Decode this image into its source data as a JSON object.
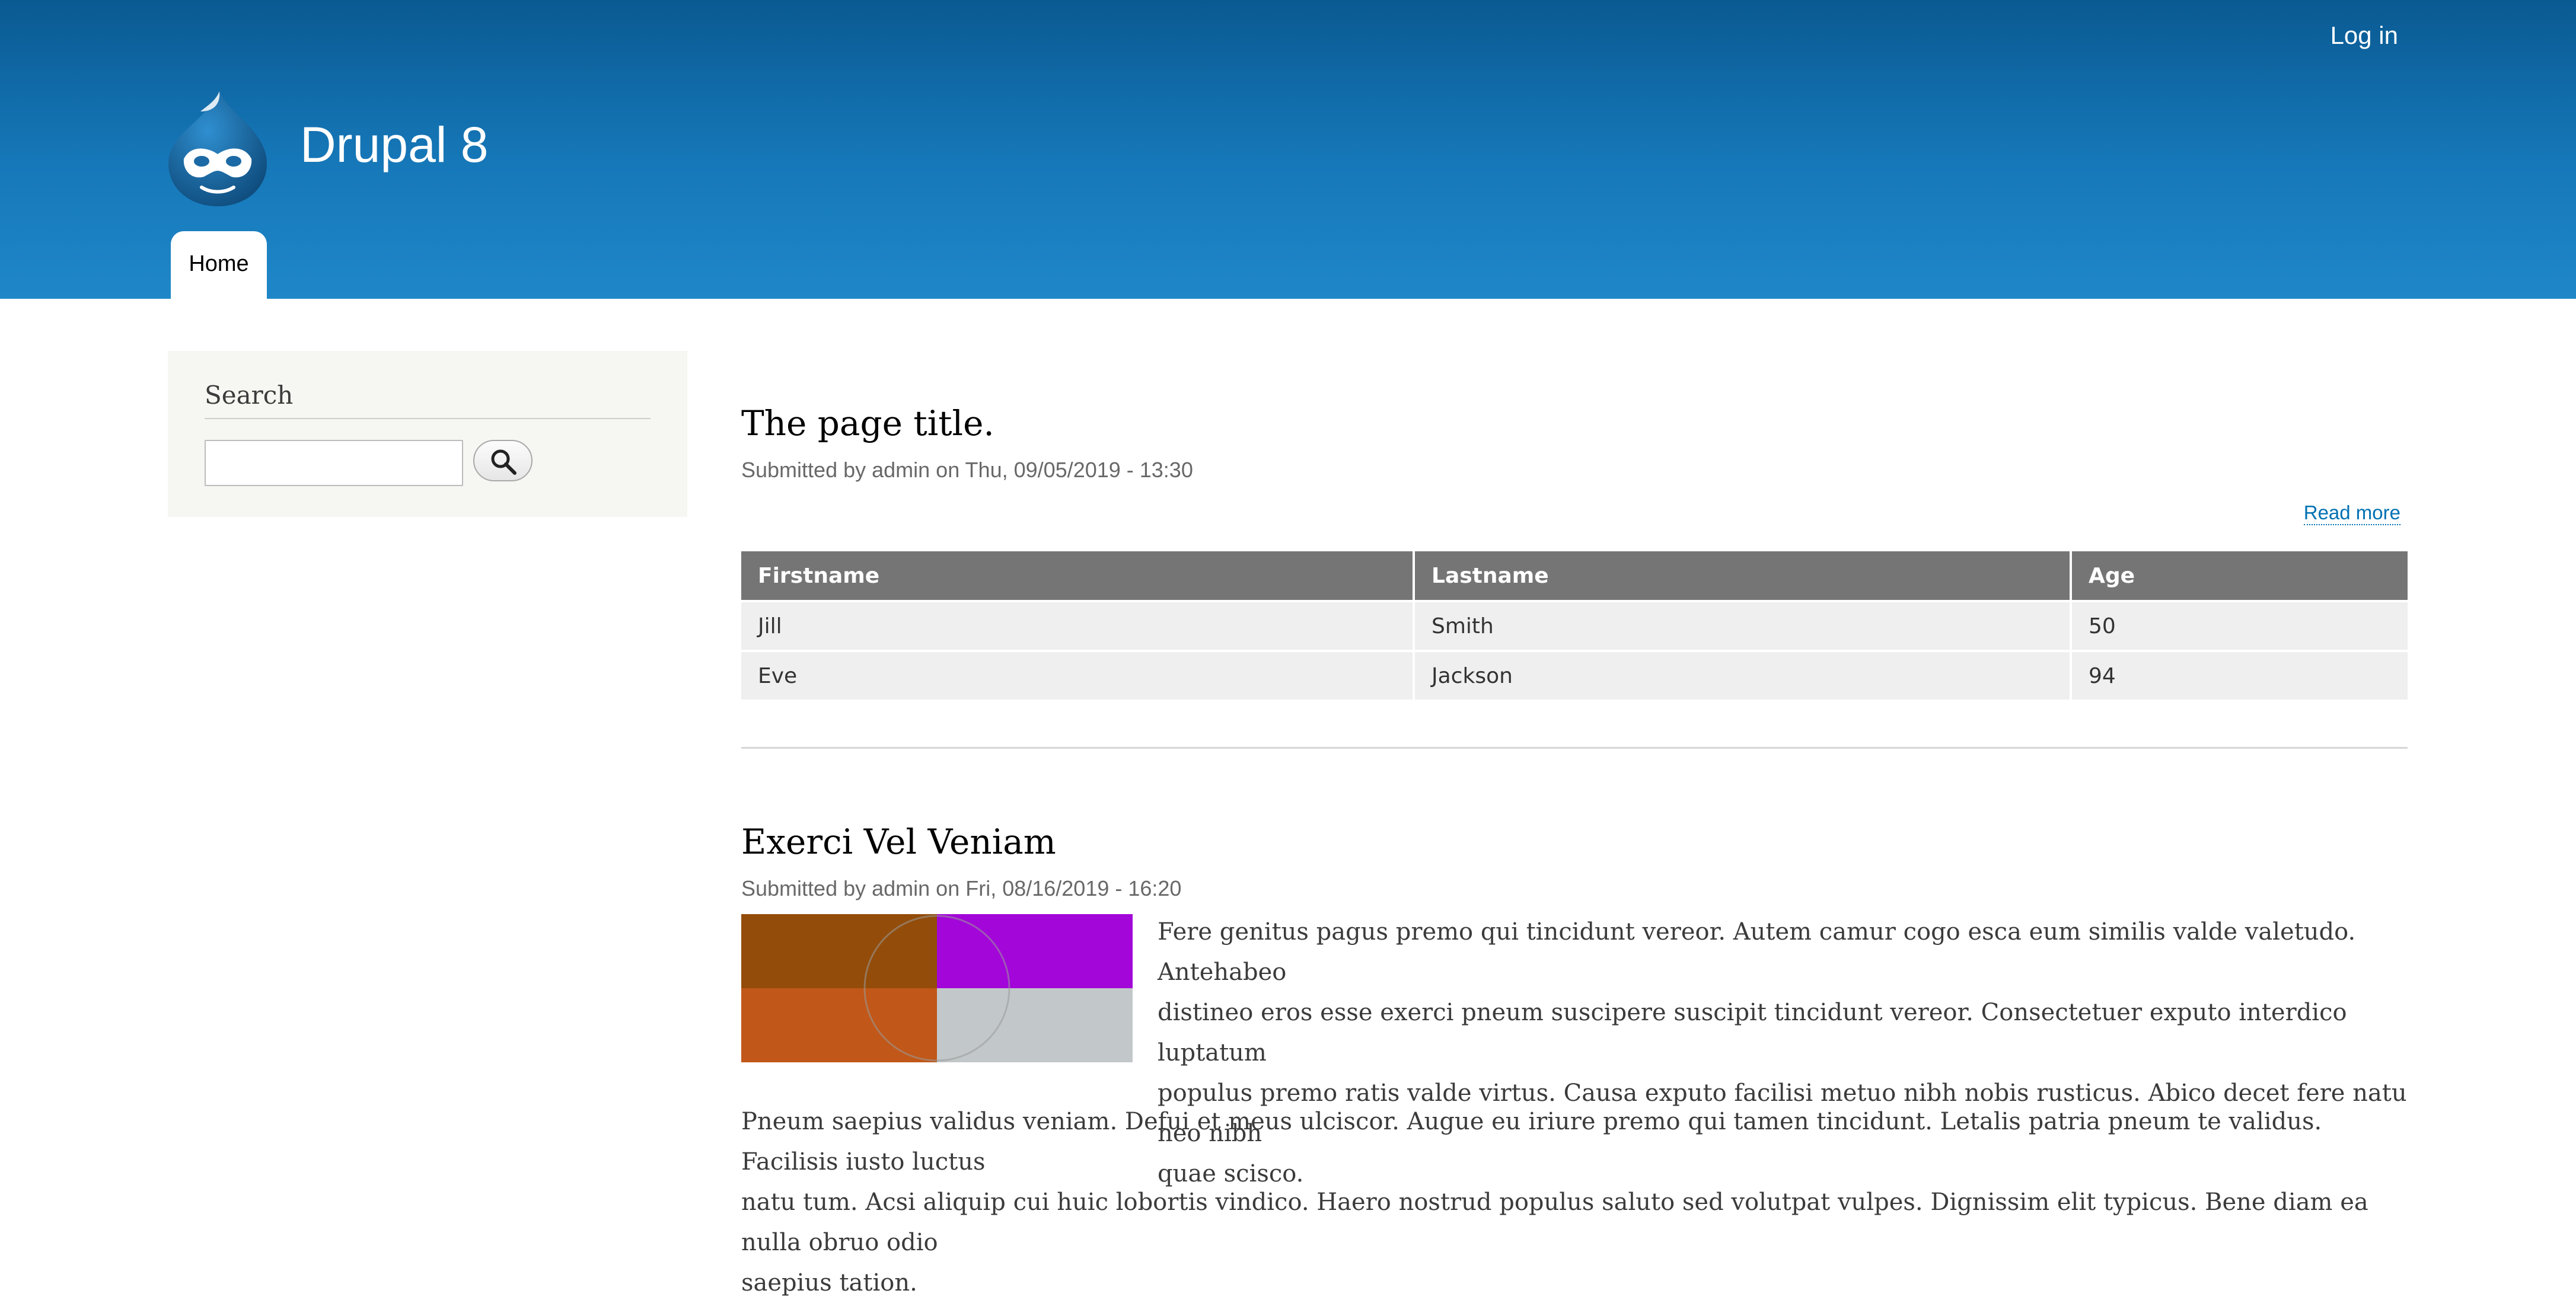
{
  "header": {
    "login_label": "Log in",
    "site_name": "Drupal 8",
    "nav": [
      {
        "label": "Home"
      }
    ],
    "gradient_top": "#0a5a92",
    "gradient_bottom": "#1f87c8"
  },
  "sidebar": {
    "search_heading": "Search",
    "search_value": "",
    "search_button_icon": "search-icon"
  },
  "main": {
    "article1": {
      "title": "The page title.",
      "submitted": "Submitted by admin on Thu, 09/05/2019 - 13:30",
      "read_more": "Read more",
      "table": {
        "headers": [
          "Firstname",
          "Lastname",
          "Age"
        ],
        "rows": [
          [
            "Jill",
            "Smith",
            "50"
          ],
          [
            "Eve",
            "Jackson",
            "94"
          ]
        ]
      }
    },
    "article2": {
      "title": "Exerci Vel Veniam",
      "submitted": "Submitted by admin on Fri, 08/16/2019 - 16:20",
      "thumbnail_colors": [
        "#934c09",
        "#a206d8",
        "#c15718",
        "#c2c8ca"
      ],
      "paragraph1_lines": [
        "Fere genitus pagus premo qui tincidunt vereor. Autem camur cogo esca eum similis valde valetudo. Antehabeo",
        "distineo eros esse exerci pneum suscipere suscipit tincidunt vereor. Consectetuer exputo interdico luptatum",
        "populus premo ratis valde virtus. Causa exputo facilisi metuo nibh nobis rusticus. Abico decet fere natu neo nibh",
        "quae scisco."
      ],
      "paragraph2_lines": [
        "Pneum saepius validus veniam. Defui et meus ulciscor. Augue eu iriure premo qui tamen tincidunt. Letalis patria pneum te validus. Facilisis iusto luctus",
        "natu tum. Acsi aliquip cui huic lobortis vindico. Haero nostrud populus saluto sed volutpat vulpes. Dignissim elit typicus. Bene diam ea nulla obruo odio",
        "saepius tation."
      ]
    }
  },
  "colors": {
    "link": "#0071b3",
    "table_header_bg": "#757575",
    "table_row_bg": "#efefef",
    "sidebar_bg": "#f6f6f2"
  }
}
